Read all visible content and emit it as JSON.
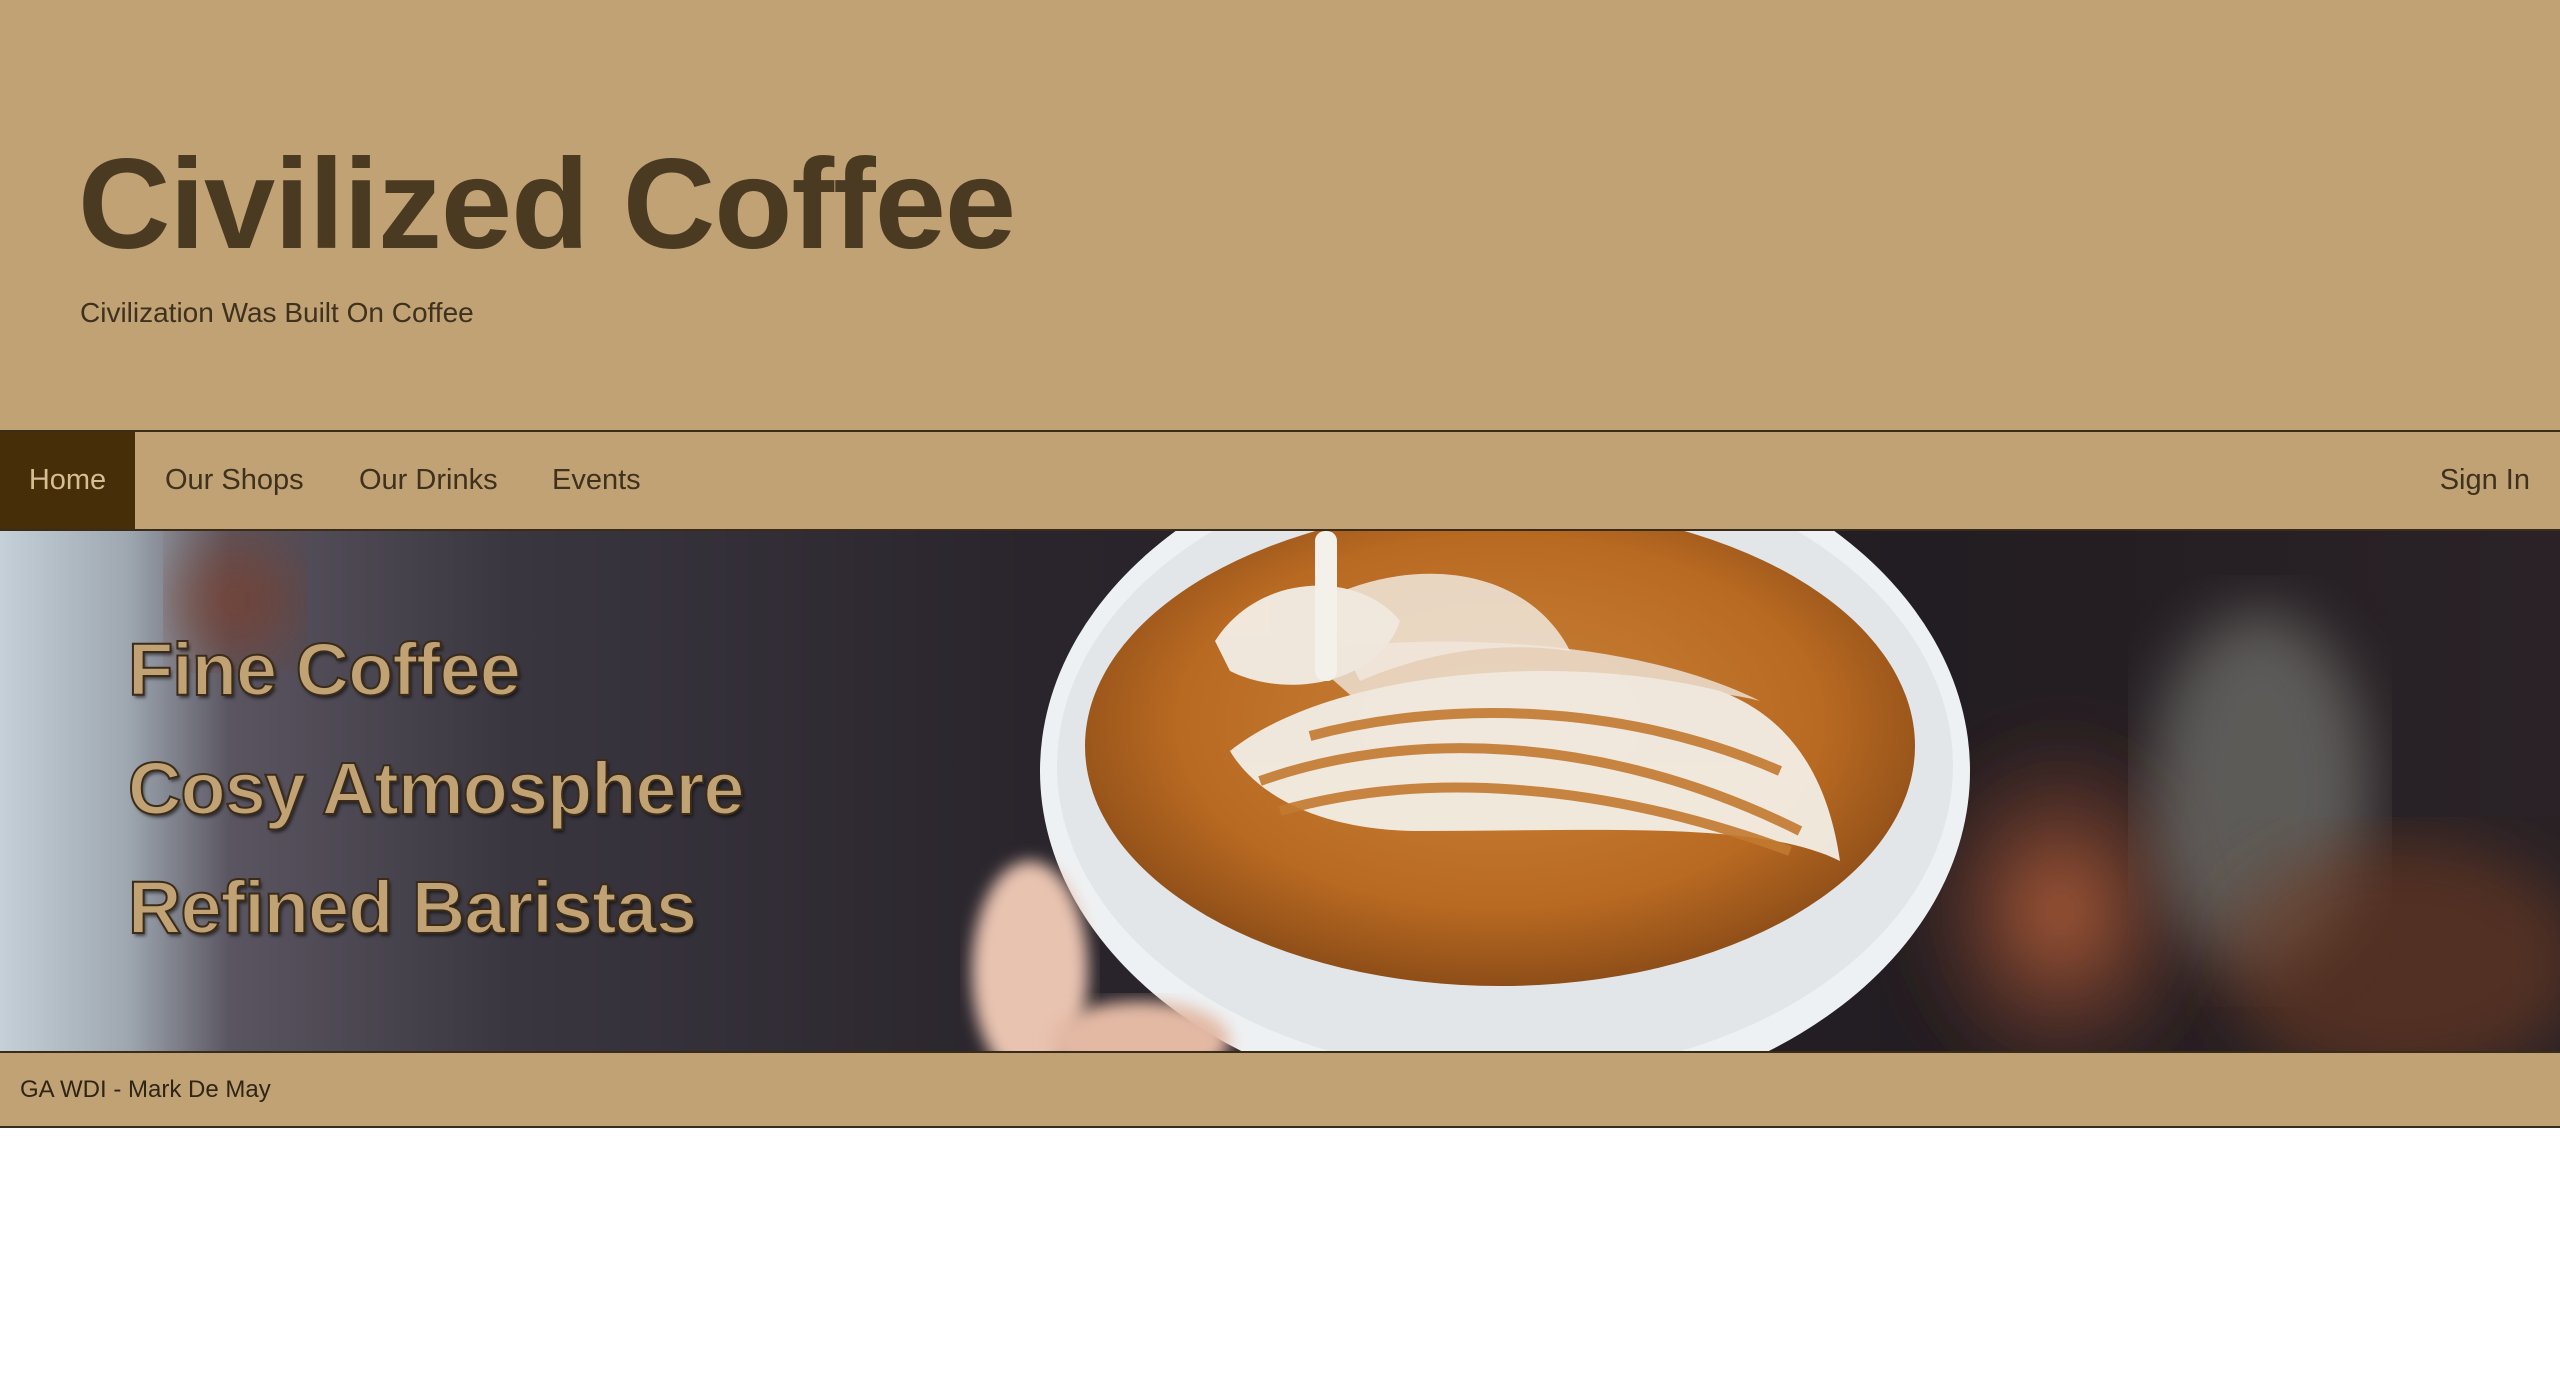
{
  "header": {
    "title": "Civilized Coffee",
    "tagline": "Civilization Was Built On Coffee"
  },
  "nav": {
    "items": [
      {
        "label": "Home",
        "active": true
      },
      {
        "label": "Our Shops",
        "active": false
      },
      {
        "label": "Our Drinks",
        "active": false
      },
      {
        "label": "Events",
        "active": false
      }
    ],
    "sign_in": "Sign In"
  },
  "hero": {
    "image": "latte-art-coffee-cup-photo",
    "lines": [
      "Fine Coffee",
      "Cosy Atmosphere",
      "Refined Baristas"
    ]
  },
  "footer": {
    "text": "GA WDI - Mark De May"
  },
  "colors": {
    "brand_tan": "#c1a274",
    "brand_dark": "#462e08",
    "text_dark": "#4a3a22"
  }
}
